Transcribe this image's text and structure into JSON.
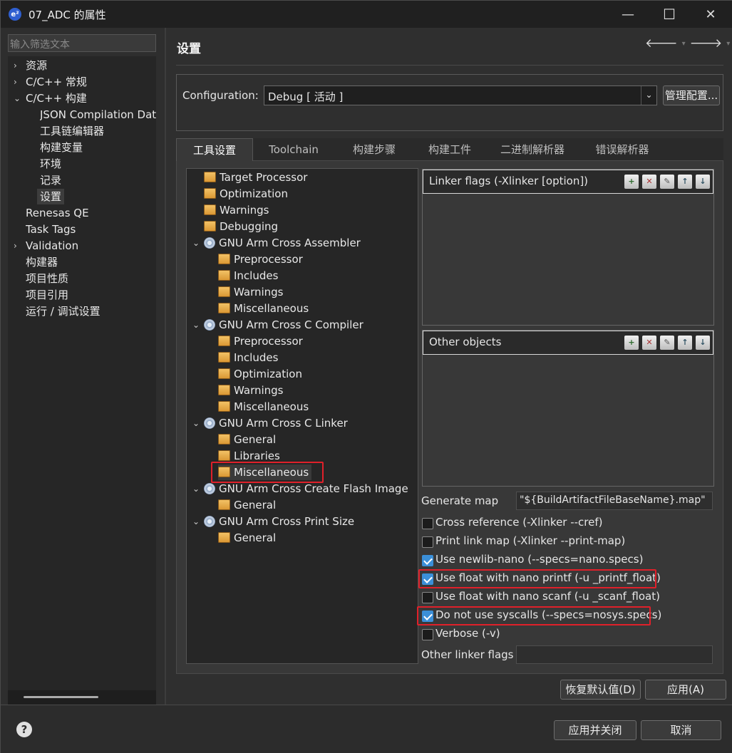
{
  "window": {
    "title": "07_ADC 的属性",
    "icon": "eclipse-e2-icon",
    "minimize": "—",
    "maximize": "☐",
    "close": "✕"
  },
  "left": {
    "filter_placeholder": "输入筛选文本",
    "items": [
      {
        "label": "资源",
        "twisty": "›"
      },
      {
        "label": "C/C++ 常规",
        "twisty": "›"
      },
      {
        "label": "C/C++ 构建",
        "twisty": "⌄"
      },
      {
        "label": "JSON Compilation Data"
      },
      {
        "label": "工具链编辑器"
      },
      {
        "label": "构建变量"
      },
      {
        "label": "环境"
      },
      {
        "label": "记录"
      },
      {
        "label": "设置"
      },
      {
        "label": "Renesas QE"
      },
      {
        "label": "Task Tags"
      },
      {
        "label": "Validation",
        "twisty": "›"
      },
      {
        "label": "构建器"
      },
      {
        "label": "项目性质"
      },
      {
        "label": "项目引用"
      },
      {
        "label": "运行 / 调试设置"
      }
    ]
  },
  "page": {
    "title": "设置",
    "back": "🡐",
    "forward": "🡒",
    "menu": "⋮",
    "drop": "▾"
  },
  "config": {
    "label": "Configuration:",
    "value": "Debug  [ 活动 ]",
    "manage": "管理配置..."
  },
  "tabs": [
    "工具设置",
    "Toolchain",
    "构建步骤",
    "构建工件",
    "二进制解析器",
    "错误解析器"
  ],
  "tree": [
    {
      "label": "Target Processor",
      "icon": "folder"
    },
    {
      "label": "Optimization",
      "icon": "folder"
    },
    {
      "label": "Warnings",
      "icon": "folder"
    },
    {
      "label": "Debugging",
      "icon": "folder"
    },
    {
      "label": "GNU Arm Cross Assembler",
      "icon": "gear",
      "twisty": "⌄"
    },
    {
      "label": "Preprocessor",
      "icon": "folder"
    },
    {
      "label": "Includes",
      "icon": "folder"
    },
    {
      "label": "Warnings",
      "icon": "folder"
    },
    {
      "label": "Miscellaneous",
      "icon": "folder"
    },
    {
      "label": "GNU Arm Cross C Compiler",
      "icon": "gear",
      "twisty": "⌄"
    },
    {
      "label": "Preprocessor",
      "icon": "folder"
    },
    {
      "label": "Includes",
      "icon": "folder"
    },
    {
      "label": "Optimization",
      "icon": "folder"
    },
    {
      "label": "Warnings",
      "icon": "folder"
    },
    {
      "label": "Miscellaneous",
      "icon": "folder"
    },
    {
      "label": "GNU Arm Cross C Linker",
      "icon": "gear",
      "twisty": "⌄"
    },
    {
      "label": "General",
      "icon": "folder"
    },
    {
      "label": "Libraries",
      "icon": "folder"
    },
    {
      "label": "Miscellaneous",
      "icon": "folder"
    },
    {
      "label": "GNU Arm Cross Create Flash Image",
      "icon": "gear",
      "twisty": "⌄"
    },
    {
      "label": "General",
      "icon": "folder"
    },
    {
      "label": "GNU Arm Cross Print Size",
      "icon": "gear",
      "twisty": "⌄"
    },
    {
      "label": "General",
      "icon": "folder"
    }
  ],
  "linker_flags": {
    "title": "Linker flags (-Xlinker [option])"
  },
  "other_objects": {
    "title": "Other objects"
  },
  "tools": [
    "add-icon",
    "delete-icon",
    "edit-icon",
    "move-up-icon",
    "move-down-icon"
  ],
  "generate_map": {
    "label": "Generate map",
    "value": "\"${BuildArtifactFileBaseName}.map\""
  },
  "checks": [
    {
      "label": "Cross reference (-Xlinker --cref)",
      "checked": false
    },
    {
      "label": "Print link map (-Xlinker --print-map)",
      "checked": false
    },
    {
      "label": "Use newlib-nano (--specs=nano.specs)",
      "checked": true
    },
    {
      "label": "Use float with nano printf (-u _printf_float)",
      "checked": true
    },
    {
      "label": "Use float with nano scanf (-u _scanf_float)",
      "checked": false
    },
    {
      "label": "Do not use syscalls (--specs=nosys.specs)",
      "checked": true
    },
    {
      "label": "Verbose (-v)",
      "checked": false
    }
  ],
  "other_linker_flags": {
    "label": "Other linker flags",
    "value": ""
  },
  "buttons": {
    "restore": "恢复默认值(D)",
    "apply": "应用(A)",
    "apply_close": "应用并关闭",
    "cancel": "取消",
    "help": "?"
  }
}
